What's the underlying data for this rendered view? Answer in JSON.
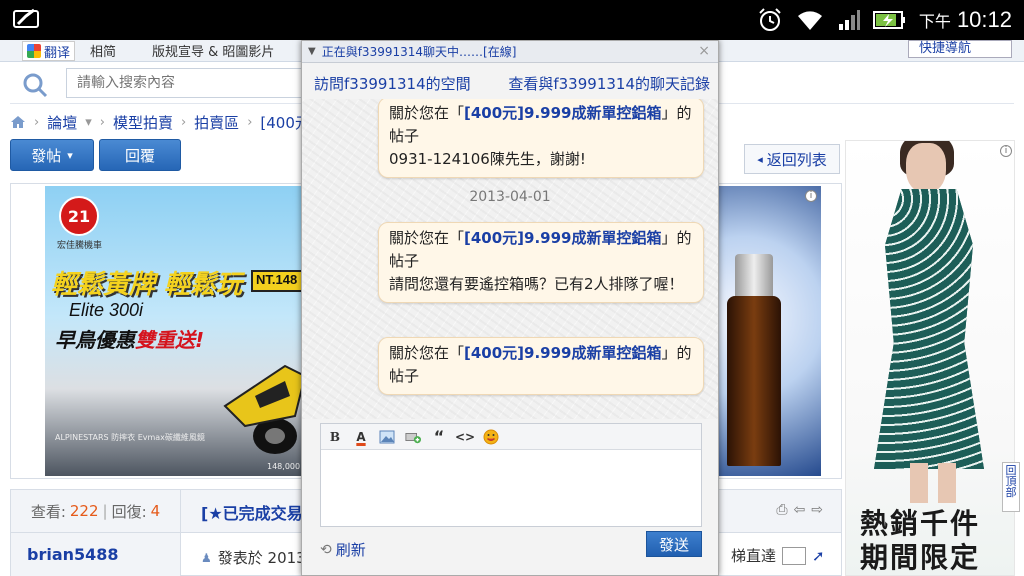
{
  "status_bar": {
    "ampm": "下午",
    "time": "10:12"
  },
  "page": {
    "translate_label": "翻译",
    "topnav": [
      "相简",
      "版规宣导 & 昭圖影片"
    ],
    "quick_nav": "快捷導航",
    "search": {
      "placeholder": "請輸入搜索內容"
    },
    "breadcrumb": [
      "論壇",
      "模型拍賣",
      "拍賣區",
      "[400元"
    ],
    "post_button": "發帖",
    "reply_button": "回覆",
    "return_button": "返回列表",
    "moto_ad": {
      "logo": "21",
      "logo_text": "宏佳騰機車",
      "slogan": "輕鬆黃牌 輕鬆玩",
      "model": "Elite 300i",
      "promo_prefix": "早鳥優惠",
      "promo_highlight": "雙重送!",
      "plate": "NT.148",
      "bottom": "ALPINESTARS 防摔衣   Evmax碳纖維風鏡",
      "price": "148,000"
    },
    "dress_ad": {
      "line1": "熱銷千件",
      "line2": "期間限定"
    },
    "back_to_top": "回頂部",
    "stats": {
      "views_label": "查看:",
      "views": "222",
      "sep": "|",
      "replies_label": "回復:",
      "replies": "4"
    },
    "thread_title": "[★已完成交易",
    "author": "brian5488",
    "posted": "發表於 2013",
    "jump_label": "梯直達"
  },
  "chat": {
    "title": "正在與f33991314聊天中……[在線]",
    "close": "×",
    "visit_link": "訪問f33991314的空間",
    "history_link": "查看與f33991314的聊天記錄",
    "messages": [
      {
        "prefix": "關於您在「",
        "item": "[400元]9.999成新單控鋁箱",
        "suffix": "」的帖子",
        "text": "0931-124106陳先生，謝謝!"
      },
      {
        "prefix": "關於您在「",
        "item": "[400元]9.999成新單控鋁箱",
        "suffix": "」的帖子",
        "text": "請問您還有要遙控箱嗎？已有2人排隊了喔！"
      },
      {
        "prefix": "關於您在「",
        "item": "[400元]9.999成新單控鋁箱",
        "suffix": "」的帖子",
        "text": ""
      }
    ],
    "date_separator": "2013-04-01",
    "toolbar": [
      "B",
      "A",
      "image",
      "attach",
      "quote",
      "code",
      "smiley"
    ],
    "refresh": "刷新",
    "send": "發送"
  },
  "colors": {
    "link": "#1a3fa5",
    "button_blue": "#2666b6",
    "bubble_bg": "#fff7e8"
  }
}
